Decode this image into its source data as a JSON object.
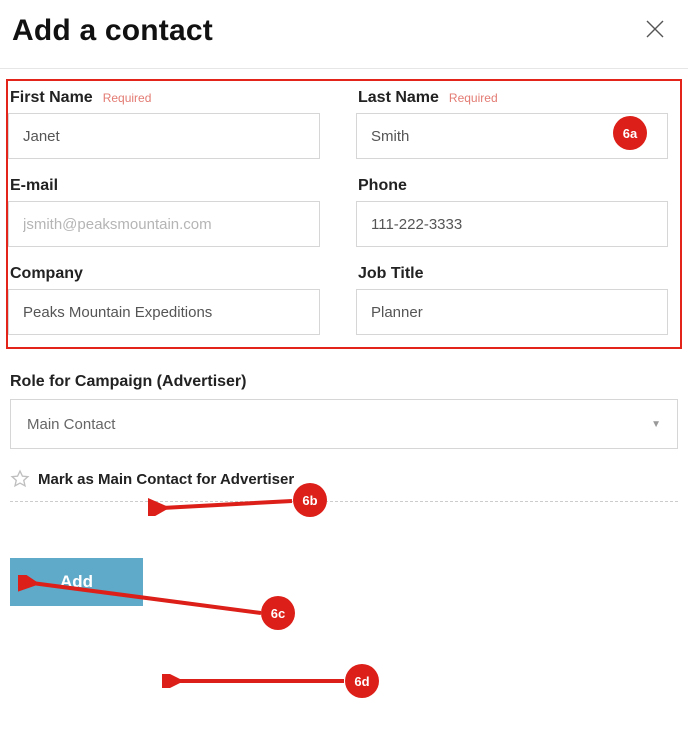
{
  "header": {
    "title": "Add a contact"
  },
  "fields": {
    "first_name": {
      "label": "First Name",
      "required": "Required",
      "value": "Janet"
    },
    "last_name": {
      "label": "Last Name",
      "required": "Required",
      "value": "Smith"
    },
    "email": {
      "label": "E-mail",
      "placeholder": "jsmith@peaksmountain.com"
    },
    "phone": {
      "label": "Phone",
      "value": "111-222-3333"
    },
    "company": {
      "label": "Company",
      "value": "Peaks Mountain Expeditions"
    },
    "job_title": {
      "label": "Job Title",
      "value": "Planner"
    }
  },
  "role": {
    "label": "Role for Campaign (Advertiser)",
    "selected": "Main Contact"
  },
  "mark_main": {
    "label": "Mark as Main Contact for Advertiser"
  },
  "actions": {
    "add_label": "Add"
  },
  "callouts": {
    "a": "6a",
    "b": "6b",
    "c": "6c",
    "d": "6d"
  }
}
